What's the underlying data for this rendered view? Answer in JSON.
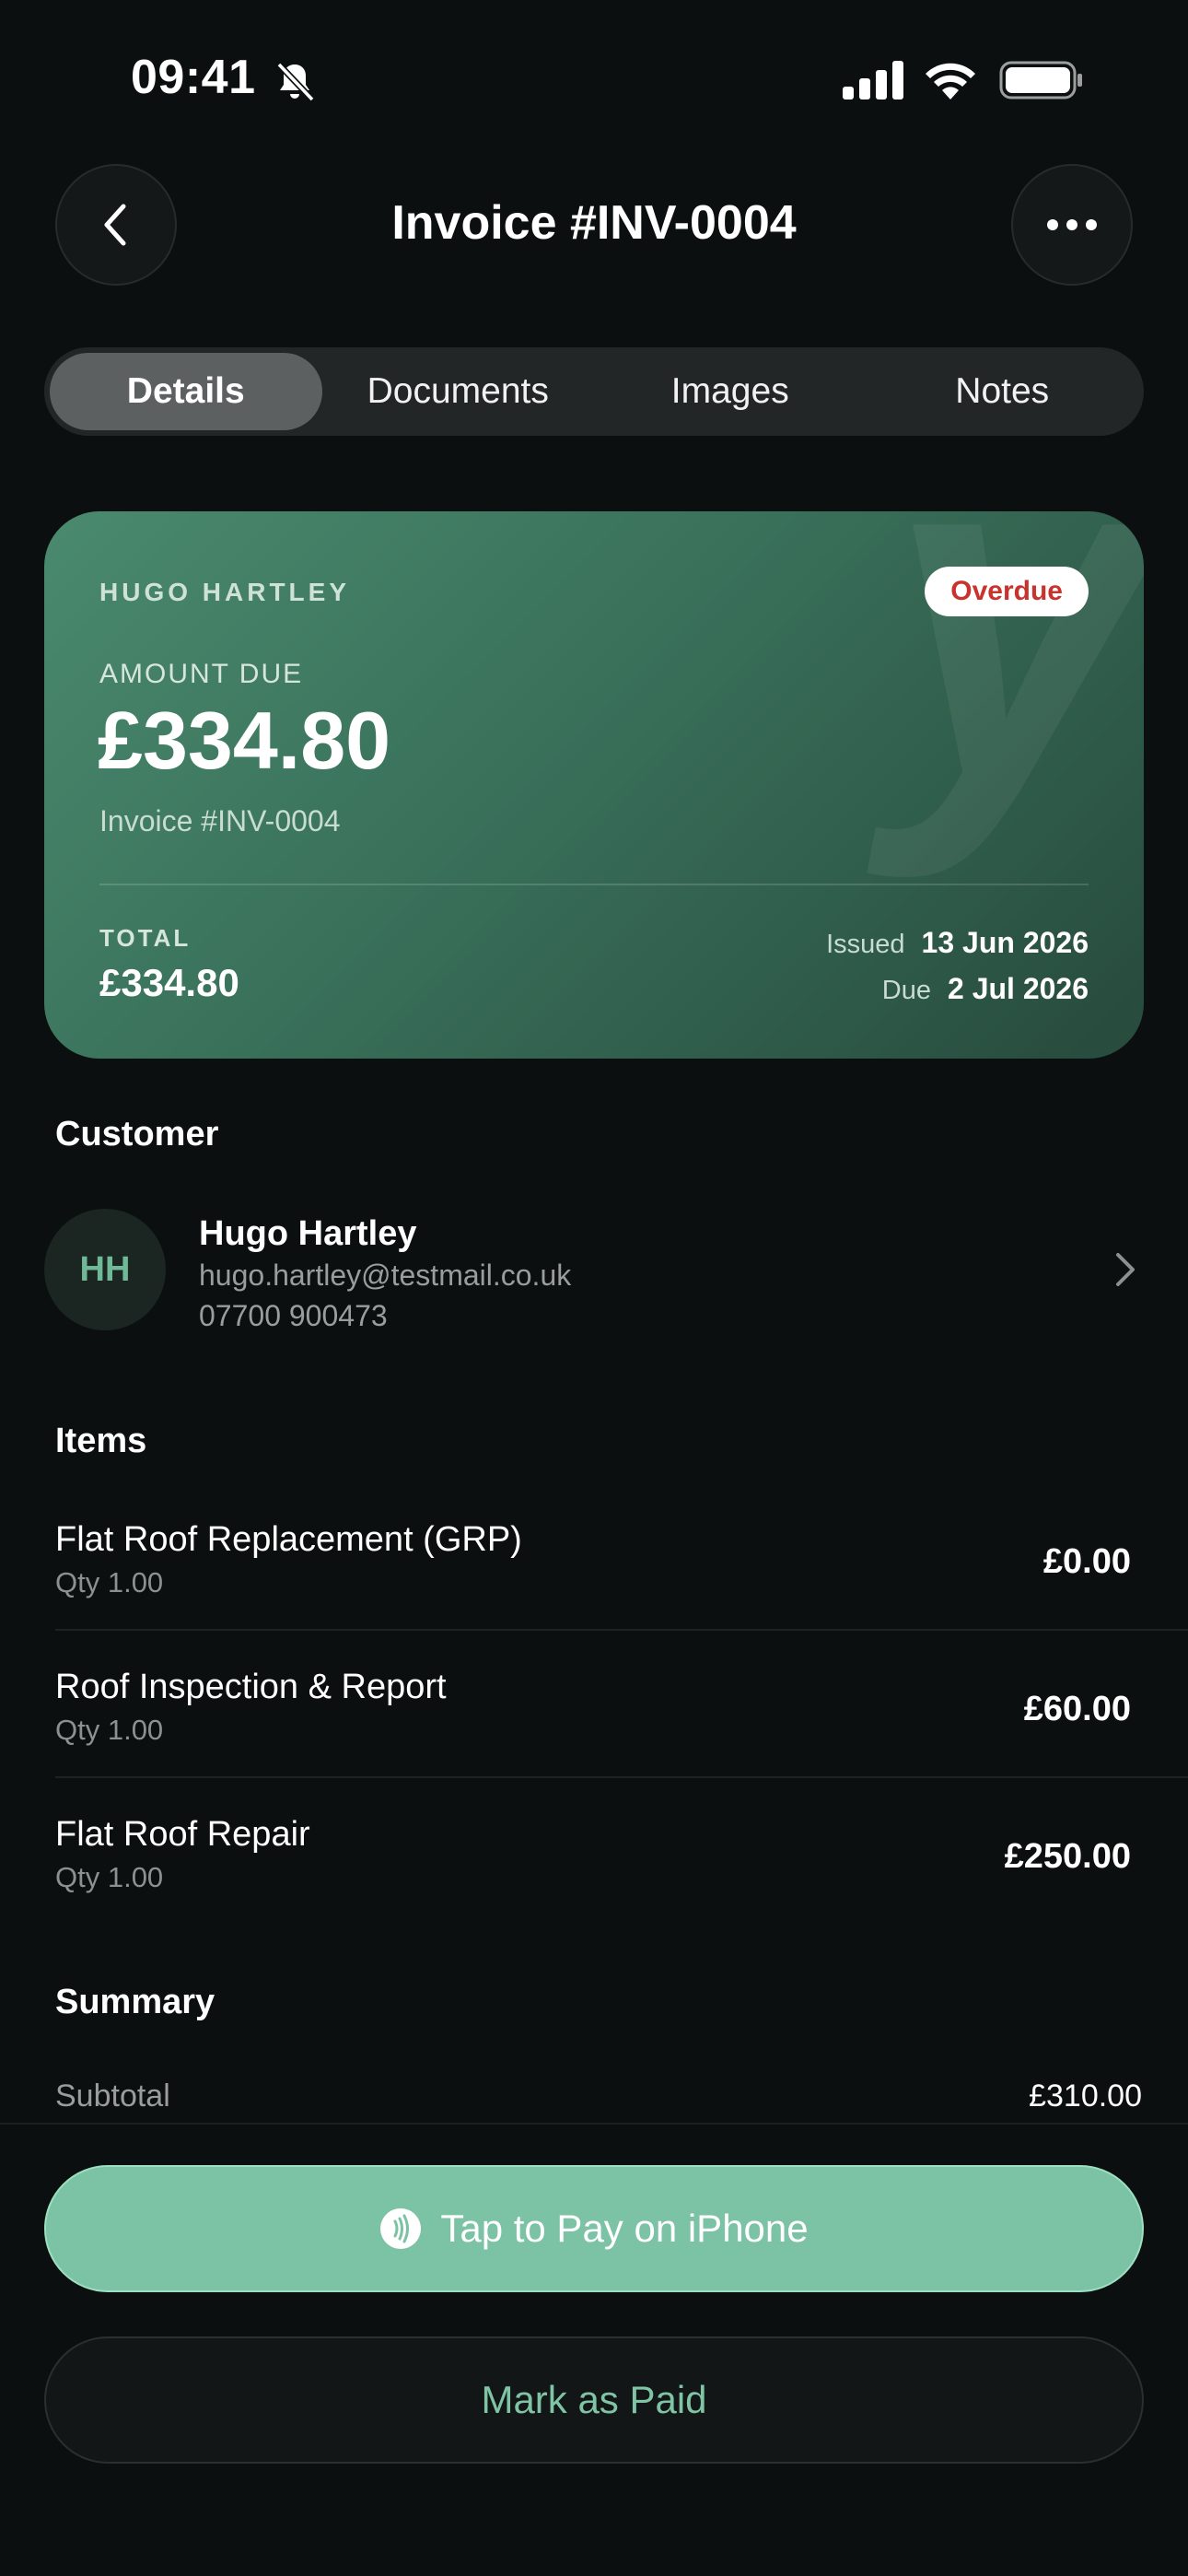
{
  "status_bar": {
    "time": "09:41"
  },
  "nav": {
    "title": "Invoice #INV-0004"
  },
  "tabs": [
    {
      "label": "Details",
      "active": true
    },
    {
      "label": "Documents",
      "active": false
    },
    {
      "label": "Images",
      "active": false
    },
    {
      "label": "Notes",
      "active": false
    }
  ],
  "card": {
    "customer_name": "HUGO HARTLEY",
    "status_badge": "Overdue",
    "amount_label": "AMOUNT DUE",
    "amount": "£334.80",
    "invoice_ref": "Invoice #INV-0004",
    "total_label": "TOTAL",
    "total": "£334.80",
    "issued_label": "Issued",
    "issued_date": "13 Jun 2026",
    "due_label": "Due",
    "due_date": "2 Jul 2026",
    "watermark": "y",
    "accent_color": "#3e7a60",
    "badge_color": "#c8332e"
  },
  "customer": {
    "section_title": "Customer",
    "initials": "HH",
    "name": "Hugo Hartley",
    "email": "hugo.hartley@testmail.co.uk",
    "phone": "07700 900473"
  },
  "items": {
    "section_title": "Items",
    "rows": [
      {
        "name": "Flat Roof Replacement (GRP)",
        "qty": "Qty 1.00",
        "price": "£0.00"
      },
      {
        "name": "Roof Inspection & Report",
        "qty": "Qty 1.00",
        "price": "£60.00"
      },
      {
        "name": "Flat Roof Repair",
        "qty": "Qty 1.00",
        "price": "£250.00"
      }
    ]
  },
  "summary": {
    "section_title": "Summary",
    "subtotal_label": "Subtotal",
    "subtotal_value": "£310.00"
  },
  "actions": {
    "tap_to_pay": "Tap to Pay on iPhone",
    "mark_paid": "Mark as Paid",
    "primary_color": "#7cc2a4"
  }
}
